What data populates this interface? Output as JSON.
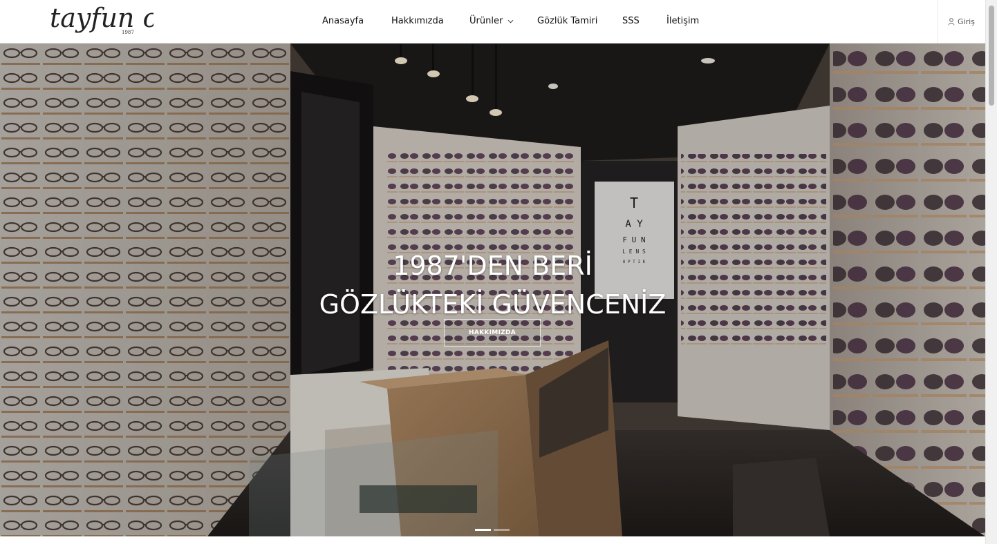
{
  "brand": {
    "logo_text": "tayfun optik",
    "logo_year": "1987"
  },
  "nav": {
    "items": [
      {
        "label": "Anasayfa"
      },
      {
        "label": "Hakkımızda"
      },
      {
        "label": "Ürünler",
        "has_dropdown": true
      },
      {
        "label": "Gözlük Tamiri"
      },
      {
        "label": "SSS"
      },
      {
        "label": "İletişim"
      }
    ],
    "login_label": "Giriş",
    "login_icon": "user-icon",
    "dropdown_icon": "chevron-down-icon"
  },
  "hero": {
    "title_line1": "1987'DEN BERİ",
    "title_line2": "GÖZLÜKTEKİ GÜVENCENİZ",
    "button_label": "HAKKIMIZDA",
    "slides_total": 2,
    "active_slide": 1,
    "eye_chart_letters": [
      "T",
      "A Y",
      "F U N",
      "L E N S",
      "O P T I K"
    ]
  },
  "colors": {
    "text": "#111111",
    "overlay": "rgba(0,0,0,0.18)",
    "active_dot": "#ffffff"
  }
}
